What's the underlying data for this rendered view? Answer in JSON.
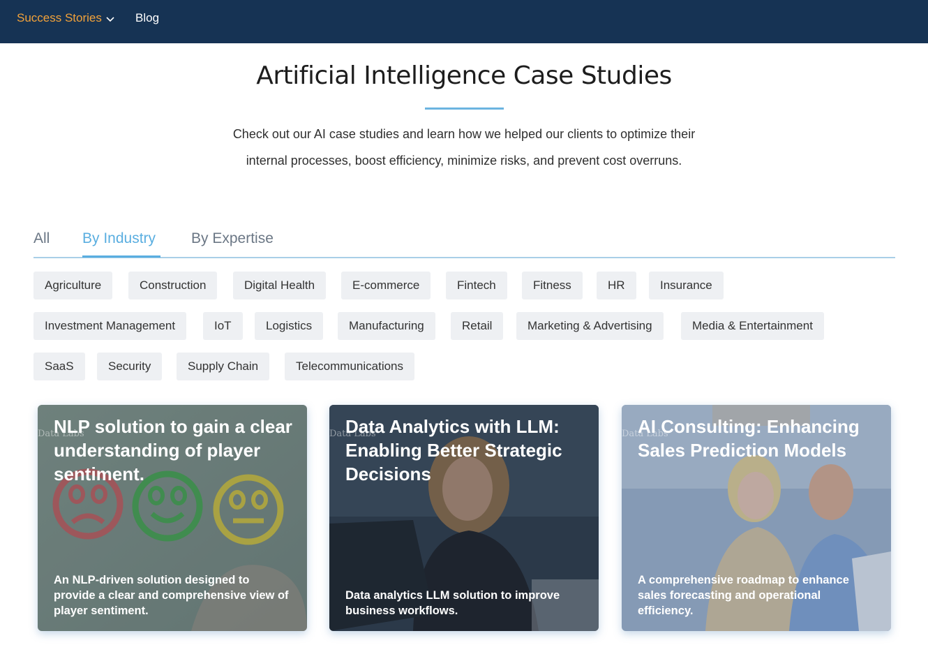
{
  "nav": {
    "success_stories": "Success Stories",
    "blog": "Blog"
  },
  "header": {
    "title": "Artificial Intelligence Case Studies",
    "intro_line1": "Check out our AI case studies and learn how we helped our clients to optimize their",
    "intro_line2": "internal processes, boost efficiency, minimize risks, and prevent cost overruns."
  },
  "tabs": [
    {
      "label": "All"
    },
    {
      "label": "By Industry",
      "active": true
    },
    {
      "label": "By Expertise"
    }
  ],
  "chips": [
    "Agriculture",
    "Construction",
    "Digital Health",
    "E-commerce",
    "Fintech",
    "Fitness",
    "HR",
    "Insurance",
    "Investment Management",
    "IoT",
    "Logistics",
    "Manufacturing",
    "Retail",
    "Marketing & Advertising",
    "Media & Entertainment",
    "SaaS",
    "Security",
    "Supply Chain",
    "Telecommunications"
  ],
  "cards": [
    {
      "title": "NLP solution to gain a clear understanding of player sentiment.",
      "description": "An NLP-driven solution designed to provide a clear and comprehensive view of player sentiment.",
      "watermark": "Data Labs"
    },
    {
      "title": "Data Analytics with LLM: Enabling Better Strategic Decisions",
      "description": "Data analytics LLM solution to improve business workflows.",
      "watermark": "Data Labs"
    },
    {
      "title": "AI Consulting: Enhancing Sales Prediction Models",
      "description": "A comprehensive roadmap to enhance sales forecasting and operational efficiency.",
      "watermark": "Data Labs"
    }
  ],
  "colors": {
    "nav_bg": "#163354",
    "nav_active": "#f2a23a",
    "accent": "#5aaee0",
    "chip_bg": "#eef0f3"
  }
}
